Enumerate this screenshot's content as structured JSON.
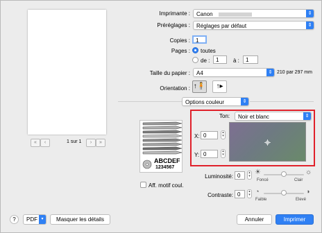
{
  "preview": {
    "pager_text": "1 sur 1",
    "first_label": "«",
    "prev_label": "‹",
    "next_label": "›",
    "last_label": "»"
  },
  "printer": {
    "label": "Imprimante :",
    "value": "Canon"
  },
  "presets": {
    "label": "Préréglages :",
    "value": "Réglages par défaut"
  },
  "copies": {
    "label": "Copies :",
    "value": "1"
  },
  "pages": {
    "label": "Pages :",
    "all_label": "toutes",
    "from_label": "de :",
    "from_value": "1",
    "to_label": "à :",
    "to_value": "1"
  },
  "paper_size": {
    "label": "Taille du papier :",
    "value": "A4",
    "dimensions": "210 par 297 mm"
  },
  "orientation": {
    "label": "Orientation :"
  },
  "section": {
    "value": "Options couleur"
  },
  "color": {
    "tone_label": "Ton:",
    "tone_value": "Noir et blanc",
    "x_label": "X:",
    "x_value": "0",
    "y_label": "Y:",
    "y_value": "0"
  },
  "sample": {
    "text_line1": "ABCDEF",
    "text_line2": "1234567"
  },
  "pattern_checkbox": {
    "label": "Aff. motif coul."
  },
  "brightness": {
    "label": "Luminosité:",
    "value": "0",
    "min_label": "Foncé",
    "max_label": "Clair",
    "level": 0.5
  },
  "contrast": {
    "label": "Contraste:",
    "value": "0",
    "min_label": "Faible",
    "max_label": "Elevé",
    "level": 0.5
  },
  "footer": {
    "help_label": "?",
    "pdf_label": "PDF",
    "details_label": "Masquer les détails",
    "cancel_label": "Annuler",
    "print_label": "Imprimer"
  },
  "colors": {
    "accent": "#2f80f4",
    "highlight": "#e0202a"
  }
}
